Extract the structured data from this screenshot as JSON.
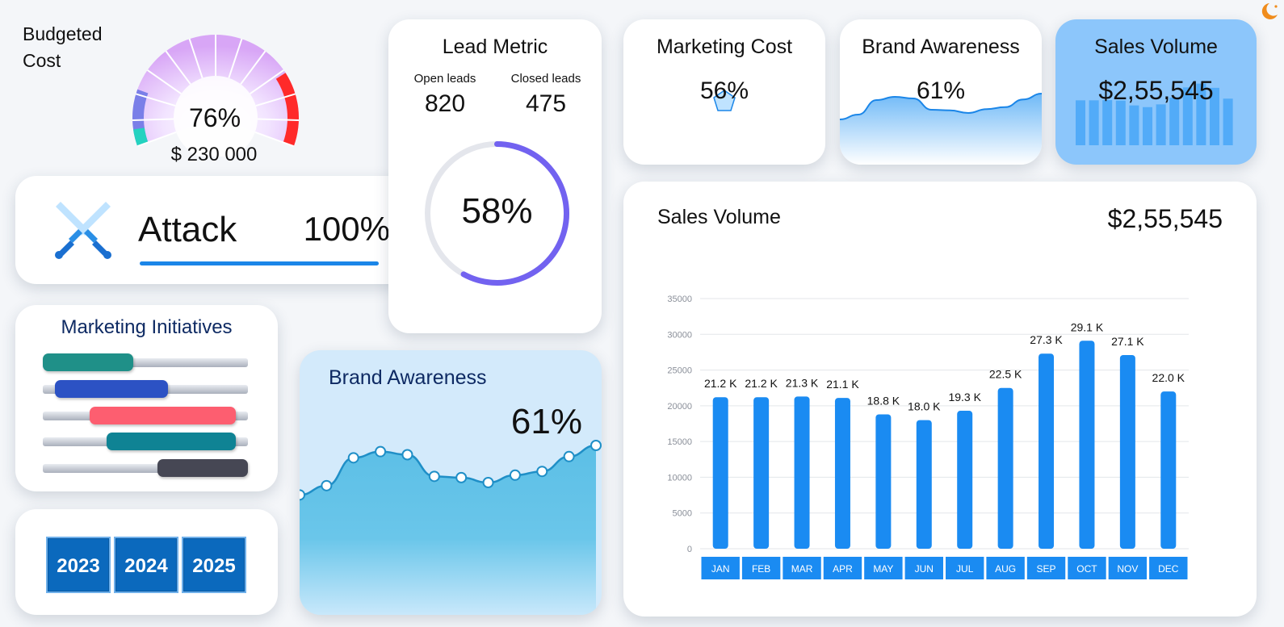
{
  "budget": {
    "title": "Budgeted Cost",
    "percent": "76%",
    "amount": "$ 230 000",
    "gauge_level": 0.76
  },
  "attack": {
    "label": "Attack",
    "value": "100%",
    "progress": 1.0
  },
  "marketing_initiatives": {
    "title": "Marketing Initiatives",
    "bars": [
      {
        "start": 0.0,
        "end": 0.44,
        "color": "#1f9088"
      },
      {
        "start": 0.06,
        "end": 0.61,
        "color": "#2c52c4"
      },
      {
        "start": 0.23,
        "end": 0.94,
        "color": "#fd5e70"
      },
      {
        "start": 0.31,
        "end": 0.94,
        "color": "#0f8394"
      },
      {
        "start": 0.56,
        "end": 1.0,
        "color": "#464754"
      }
    ]
  },
  "years": [
    "2023",
    "2024",
    "2025"
  ],
  "lead_metric": {
    "title": "Lead Metric",
    "open_label": "Open leads",
    "open_value": "820",
    "closed_label": "Closed leads",
    "closed_value": "475",
    "percent": "58%",
    "ratio": 0.58
  },
  "marketing_cost": {
    "title": "Marketing Cost",
    "value": "56%",
    "icon": "pentagon-icon"
  },
  "brand_awareness_small": {
    "title": "Brand Awareness",
    "value": "61%"
  },
  "sales_volume_small": {
    "title": "Sales Volume",
    "value": "$2,55,545"
  },
  "brand_awareness_big": {
    "title": "Brand Awareness",
    "value": "61%"
  },
  "sales_volume_big": {
    "title": "Sales Volume",
    "value": "$2,55,545"
  },
  "colors": {
    "accent": "#1b86e8",
    "bar": "#1a8bf2",
    "ring": "#7262f0",
    "area": "#5cbfe6"
  },
  "chart_data": [
    {
      "type": "bar",
      "title": "Sales Volume",
      "categories": [
        "JAN",
        "FEB",
        "MAR",
        "APR",
        "MAY",
        "JUN",
        "JUL",
        "AUG",
        "SEP",
        "OCT",
        "NOV",
        "DEC"
      ],
      "values": [
        21200,
        21200,
        21300,
        21100,
        18800,
        18000,
        19300,
        22500,
        27300,
        29100,
        27100,
        22000
      ],
      "data_labels": [
        "21.2 K",
        "21.2 K",
        "21.3 K",
        "21.1 K",
        "18.8 K",
        "18.0 K",
        "19.3 K",
        "22.5 K",
        "27.3 K",
        "29.1 K",
        "27.1 K",
        "22.0 K"
      ],
      "yticks": [
        0,
        5000,
        10000,
        15000,
        20000,
        25000,
        30000,
        35000
      ],
      "ylim": [
        0,
        35000
      ],
      "grid": true,
      "xlabel": "",
      "ylabel": ""
    },
    {
      "type": "area",
      "title": "Brand Awareness",
      "values": [
        14,
        15.5,
        20,
        21,
        20.5,
        17,
        16.8,
        16,
        17.2,
        17.8,
        20.2,
        22
      ]
    }
  ]
}
